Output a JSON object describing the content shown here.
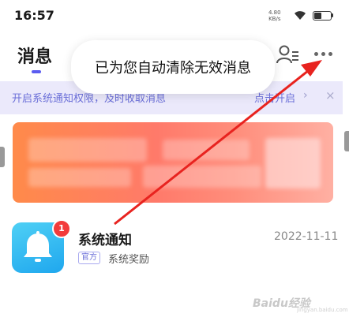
{
  "status_bar": {
    "time": "16:57",
    "speed_value": "4.80",
    "speed_unit": "KB/s"
  },
  "header": {
    "title": "消息"
  },
  "toast": {
    "text": "已为您自动清除无效消息"
  },
  "notify_banner": {
    "text": "开启系统通知权限，及时收取消息",
    "action": "点击开启",
    "chevron": "›",
    "close": "×"
  },
  "messages": [
    {
      "title": "系统通知",
      "date": "2022-11-11",
      "tag": "官方",
      "subtitle": "系统奖励",
      "badge": "1"
    }
  ],
  "watermark": {
    "text": "Baidu经验",
    "sub": "jingyan.baidu.com"
  },
  "colors": {
    "accent": "#6b6fd8",
    "arrow": "#e8231f",
    "badge": "#f23b3b",
    "promo": "#ff8a4a"
  }
}
